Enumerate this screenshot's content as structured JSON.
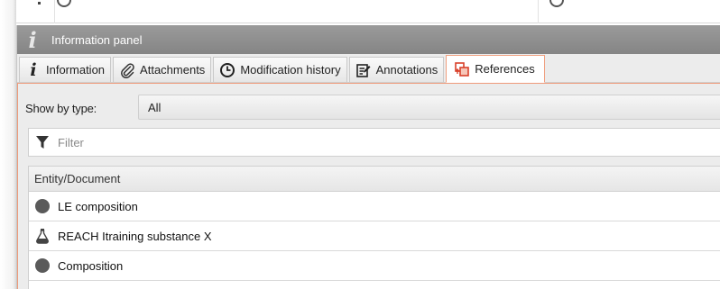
{
  "panel": {
    "title": "Information panel"
  },
  "tabs": [
    {
      "label": "Information",
      "icon": "info-icon",
      "active": false
    },
    {
      "label": "Attachments",
      "icon": "paperclip-icon",
      "active": false
    },
    {
      "label": "Modification history",
      "icon": "clock-icon",
      "active": false
    },
    {
      "label": "Annotations",
      "icon": "annotation-icon",
      "active": false
    },
    {
      "label": "References",
      "icon": "references-icon",
      "active": true
    }
  ],
  "references": {
    "show_by_type_label": "Show by type:",
    "show_by_type_value": "All",
    "filter_placeholder": "Filter",
    "column_header": "Entity/Document",
    "rows": [
      {
        "label": "LE composition",
        "icon": "composition-dot-icon"
      },
      {
        "label": "REACH Itraining substance X",
        "icon": "flask-icon"
      },
      {
        "label": "Composition",
        "icon": "composition-dot-icon"
      }
    ]
  },
  "colors": {
    "titlebar": "#8f8f8f",
    "active_tab_border": "#f0a080",
    "references_icon": "#d9402a"
  }
}
